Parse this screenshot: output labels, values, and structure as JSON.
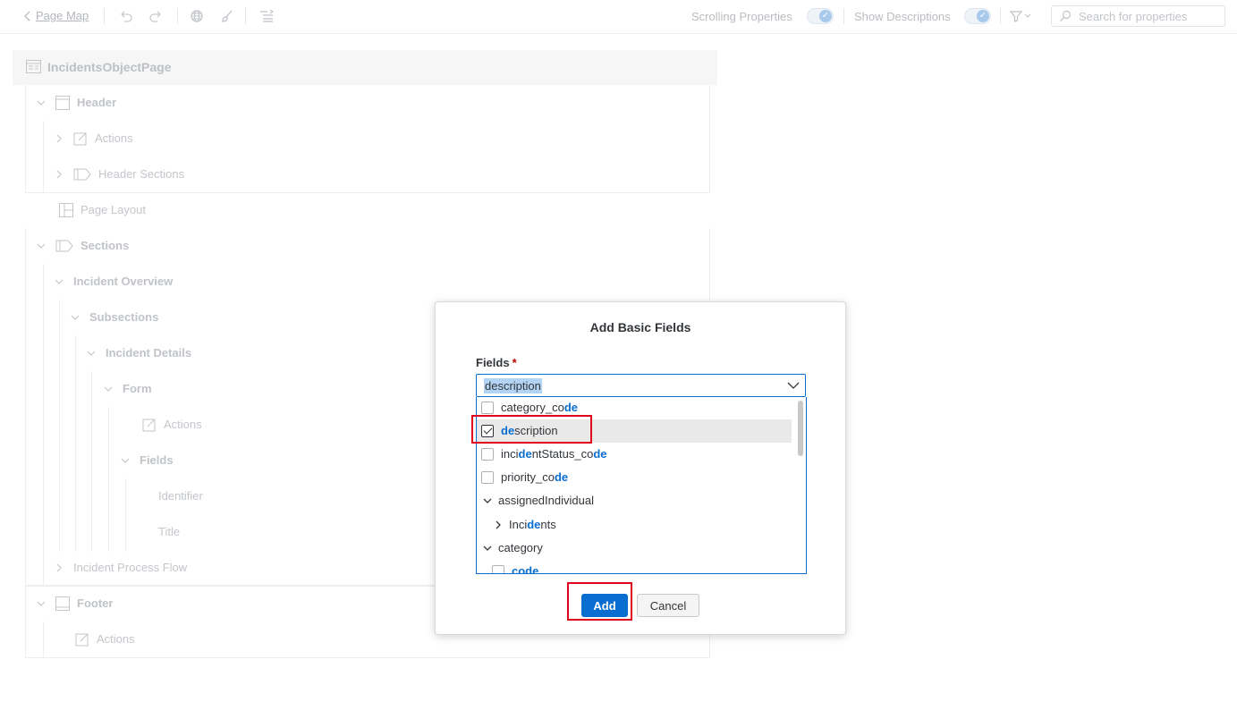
{
  "toolbar": {
    "back_label": "Page Map",
    "scrolling_properties_label": "Scrolling Properties",
    "show_descriptions_label": "Show Descriptions",
    "search_placeholder": "Search for properties"
  },
  "page_map": {
    "root": "IncidentsObjectPage",
    "header": "Header",
    "header_actions": "Actions",
    "header_sections": "Header Sections",
    "page_layout": "Page Layout",
    "sections": "Sections",
    "incident_overview": "Incident Overview",
    "subsections": "Subsections",
    "incident_details": "Incident Details",
    "form": "Form",
    "form_actions": "Actions",
    "fields": "Fields",
    "identifier": "Identifier",
    "title": "Title",
    "incident_process_flow": "Incident Process Flow",
    "footer": "Footer",
    "footer_actions": "Actions"
  },
  "dialog": {
    "title": "Add Basic Fields",
    "fields_label": "Fields",
    "required_mark": "*",
    "combo_value": "description",
    "items": [
      {
        "parts": [
          "category_co",
          "de",
          ""
        ],
        "checked": false
      },
      {
        "parts": [
          "",
          "de",
          "scription"
        ],
        "checked": true
      },
      {
        "parts": [
          "inci",
          "de",
          "ntStatus_co",
          "de"
        ],
        "checked": false
      },
      {
        "parts": [
          "priority_co",
          "de",
          ""
        ],
        "checked": false
      }
    ],
    "group_assigned": "assignedIndividual",
    "sub_incidents": [
      "Inci",
      "de",
      "nts"
    ],
    "group_category": "category",
    "partial_item": [
      "co",
      "de"
    ],
    "add_button": "Add",
    "cancel_button": "Cancel"
  },
  "colors": {
    "accent": "#0a6ed1",
    "highlight_box": "#e0001b"
  }
}
